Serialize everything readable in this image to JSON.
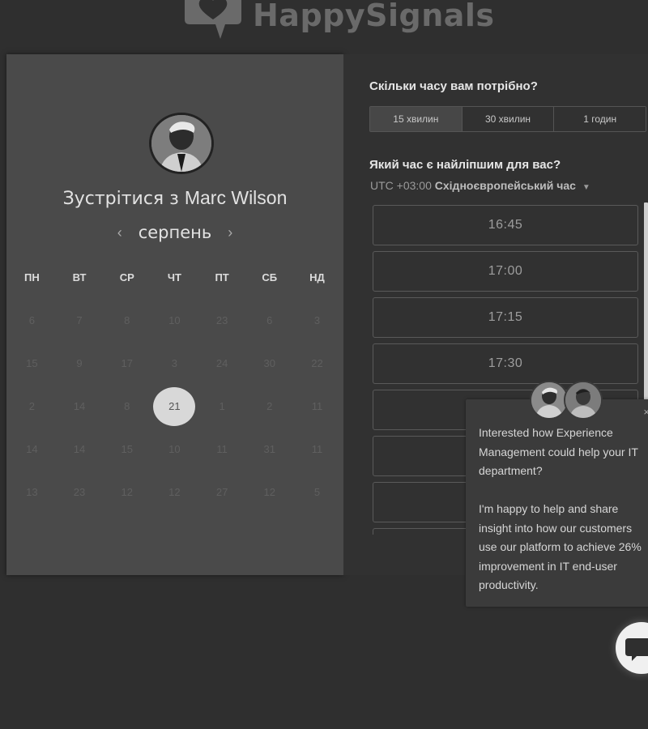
{
  "brand": {
    "name": "HappySignals",
    "icon": "heart-chat-logo-icon"
  },
  "calendar": {
    "host_prefix": "Зустрітися з",
    "host_name": "Marc Wilson",
    "avatar_icon": "host-avatar",
    "month": "серпень",
    "prev_icon": "chevron-left-icon",
    "next_icon": "chevron-right-icon",
    "weekdays": [
      "ПН",
      "ВТ",
      "СР",
      "ЧТ",
      "ПТ",
      "СБ",
      "НД"
    ],
    "weeks": [
      [
        "6",
        "7",
        "8",
        "10",
        "23",
        "6",
        "3"
      ],
      [
        "15",
        "9",
        "17",
        "3",
        "24",
        "30",
        "22"
      ],
      [
        "2",
        "14",
        "8",
        "21",
        "1",
        "2",
        "11"
      ],
      [
        "14",
        "14",
        "15",
        "10",
        "11",
        "31",
        "11"
      ],
      [
        "13",
        "23",
        "12",
        "12",
        "27",
        "12",
        "5"
      ]
    ],
    "selected_day": "21"
  },
  "scheduler": {
    "duration_question": "Скільки часу вам потрібно?",
    "durations": [
      "15 хвилин",
      "30 хвилин",
      "1 годин"
    ],
    "selected_duration": "15 хвилин",
    "time_question": "Який час є найліпшим для вас?",
    "tz_offset": "UTC +03:00",
    "tz_name": "Східноєвропейський час",
    "slots": [
      "16:45",
      "17:00",
      "17:15",
      "17:30",
      "",
      "",
      "",
      ""
    ]
  },
  "chat": {
    "message_1": "Interested how Experience Management could help your IT department?",
    "message_2": "I'm happy to help and share insight into how our customers use our platform to achieve 26% improvement in IT end-user productivity.",
    "close_label": "×"
  },
  "colors": {
    "page_bg": "#2f2f2f",
    "left_panel": "#4a4a4a",
    "right_panel": "#313131",
    "selected_day": "#d8d8d8"
  }
}
